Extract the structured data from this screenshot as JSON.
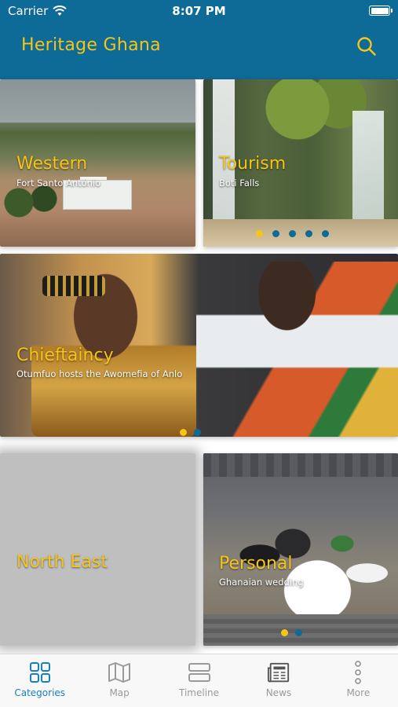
{
  "status_bar": {
    "carrier": "Carrier",
    "time": "8:07 PM"
  },
  "header": {
    "title": "Heritage Ghana",
    "search_icon": "search-icon"
  },
  "colors": {
    "header_bg": "#0e6a96",
    "accent": "#f5c518",
    "tab_active": "#1a7fc0",
    "tab_inactive": "#9a9a9a"
  },
  "tiles": {
    "western": {
      "title": "Western",
      "subtitle": "Fort Santo António"
    },
    "tourism": {
      "title": "Tourism",
      "subtitle": "Boti Falls",
      "dot_count": 5,
      "active_dot": 1
    },
    "chieftaincy": {
      "title": "Chieftaincy",
      "subtitle": "Otumfuo hosts the Awomefia of Anlo",
      "dot_count": 2,
      "active_dot": 1
    },
    "north_east": {
      "title": "North East",
      "subtitle": ""
    },
    "personal": {
      "title": "Personal",
      "subtitle": "Ghanaian wedding",
      "dot_count": 2,
      "active_dot": 1
    }
  },
  "tabbar": {
    "items": [
      {
        "label": "Categories",
        "icon": "grid-icon",
        "active": true
      },
      {
        "label": "Map",
        "icon": "map-icon",
        "active": false
      },
      {
        "label": "Timeline",
        "icon": "timeline-icon",
        "active": false
      },
      {
        "label": "News",
        "icon": "newspaper-icon",
        "active": false
      },
      {
        "label": "More",
        "icon": "more-vertical-icon",
        "active": false
      }
    ]
  }
}
